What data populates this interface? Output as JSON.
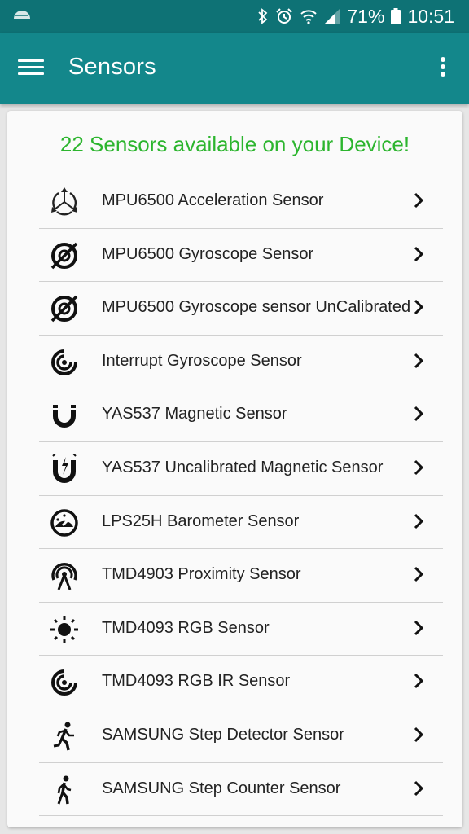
{
  "status_bar": {
    "battery": "71%",
    "time": "10:51"
  },
  "app_bar": {
    "title": "Sensors"
  },
  "summary": "22 Sensors available on your Device!",
  "colors": {
    "status_bar": "#0e7275",
    "app_bar": "#13878b",
    "summary_text": "#2cb52e"
  },
  "sensors": [
    {
      "label": "MPU6500 Acceleration Sensor",
      "icon": "acceleration-icon"
    },
    {
      "label": "MPU6500 Gyroscope Sensor",
      "icon": "gyroscope-icon"
    },
    {
      "label": "MPU6500 Gyroscope sensor UnCalibrated",
      "icon": "gyroscope-icon"
    },
    {
      "label": "Interrupt Gyroscope Sensor",
      "icon": "spiral-icon"
    },
    {
      "label": "YAS537 Magnetic Sensor",
      "icon": "magnet-icon"
    },
    {
      "label": "YAS537 Uncalibrated Magnetic Sensor",
      "icon": "magnet-flash-icon"
    },
    {
      "label": "LPS25H Barometer Sensor",
      "icon": "gauge-icon"
    },
    {
      "label": "TMD4903 Proximity Sensor",
      "icon": "proximity-icon"
    },
    {
      "label": "TMD4093 RGB Sensor",
      "icon": "sun-icon"
    },
    {
      "label": "TMD4093 RGB IR Sensor",
      "icon": "spiral-icon"
    },
    {
      "label": "SAMSUNG Step Detector Sensor",
      "icon": "running-icon"
    },
    {
      "label": "SAMSUNG Step Counter Sensor",
      "icon": "walking-icon"
    }
  ]
}
